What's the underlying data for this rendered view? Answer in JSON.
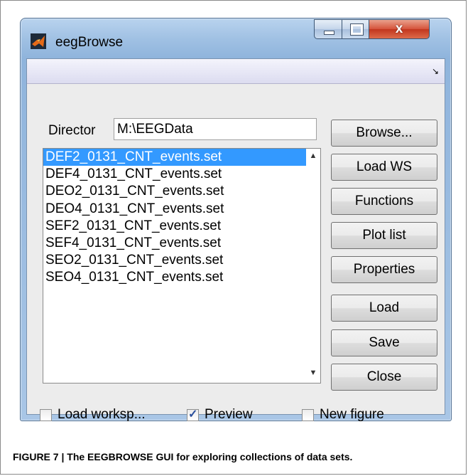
{
  "window": {
    "title": "eegBrowse",
    "close_glyph": "x"
  },
  "directory": {
    "label": "Director",
    "value": "M:\\EEGData"
  },
  "files": [
    {
      "name": "DEF2_0131_CNT_events.set",
      "selected": true
    },
    {
      "name": "DEF4_0131_CNT_events.set",
      "selected": false
    },
    {
      "name": "DEO2_0131_CNT_events.set",
      "selected": false
    },
    {
      "name": "DEO4_0131_CNT_events.set",
      "selected": false
    },
    {
      "name": "SEF2_0131_CNT_events.set",
      "selected": false
    },
    {
      "name": "SEF4_0131_CNT_events.set",
      "selected": false
    },
    {
      "name": "SEO2_0131_CNT_events.set",
      "selected": false
    },
    {
      "name": "SEO4_0131_CNT_events.set",
      "selected": false
    }
  ],
  "buttons": {
    "browse": "Browse...",
    "load_ws": "Load WS",
    "functions": "Functions",
    "plot_list": "Plot list",
    "properties": "Properties",
    "load": "Load",
    "save": "Save",
    "close": "Close"
  },
  "checkboxes": {
    "load_workspace": {
      "label": "Load worksp...",
      "checked": false
    },
    "preview": {
      "label": "Preview",
      "checked": true
    },
    "new_figure": {
      "label": "New figure",
      "checked": false
    }
  },
  "caption": "FIGURE 7 | The EEGBROWSE GUI for exploring collections of data sets.",
  "colors": {
    "selection": "#3399ff",
    "title_bar": "#9fc0e3",
    "close_button": "#c2361e"
  }
}
